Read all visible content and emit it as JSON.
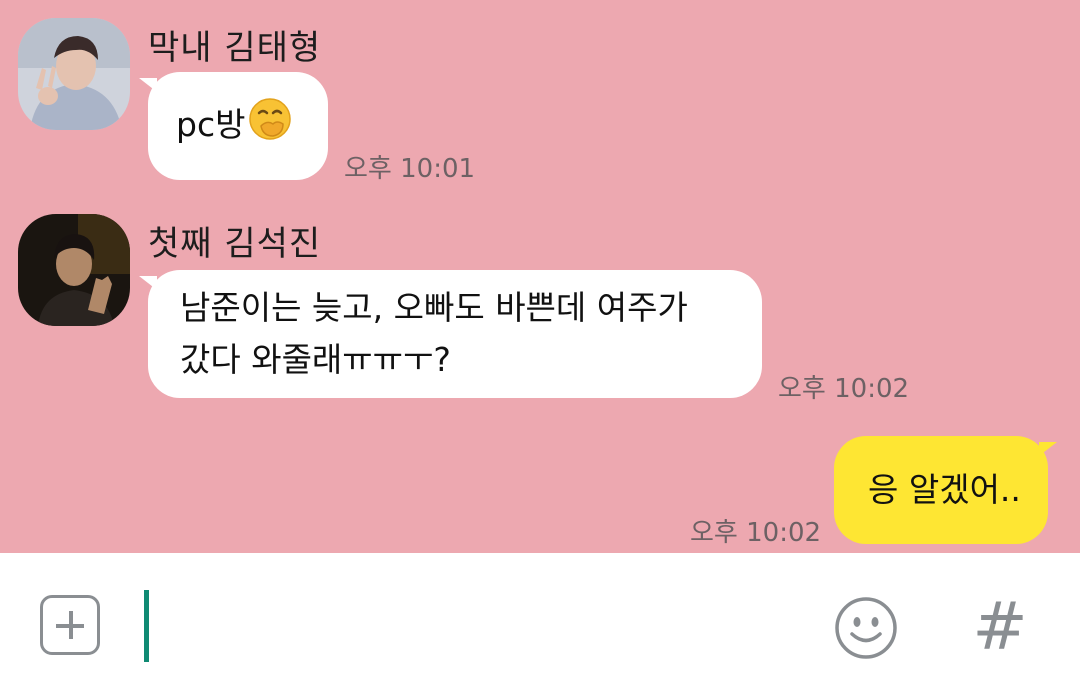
{
  "messages": [
    {
      "sender": "막내 김태형",
      "text": "pc방",
      "emoji": "face-with-hand-over-mouth",
      "time": "오후 10:01",
      "direction": "received"
    },
    {
      "sender": "첫째 김석진",
      "lines": [
        "남준이는 늦고, 오빠도 바쁜데 여주가",
        "갔다 와줄래ㅠㅠㅜ?"
      ],
      "time": "오후 10:02",
      "direction": "received"
    },
    {
      "text": "응 알겠어..",
      "time": "오후 10:02",
      "direction": "sent"
    }
  ],
  "input": {
    "value": "",
    "placeholder": ""
  },
  "toolbar": {
    "hash_label": "#"
  },
  "colors": {
    "chat_background": "#eda8b0",
    "received_bubble": "#ffffff",
    "sent_bubble": "#fee633",
    "caret": "#0f8a73",
    "icon_gray": "#8a8e92"
  },
  "icons": [
    "plus-icon",
    "emoji-icon",
    "hashtag-icon"
  ]
}
